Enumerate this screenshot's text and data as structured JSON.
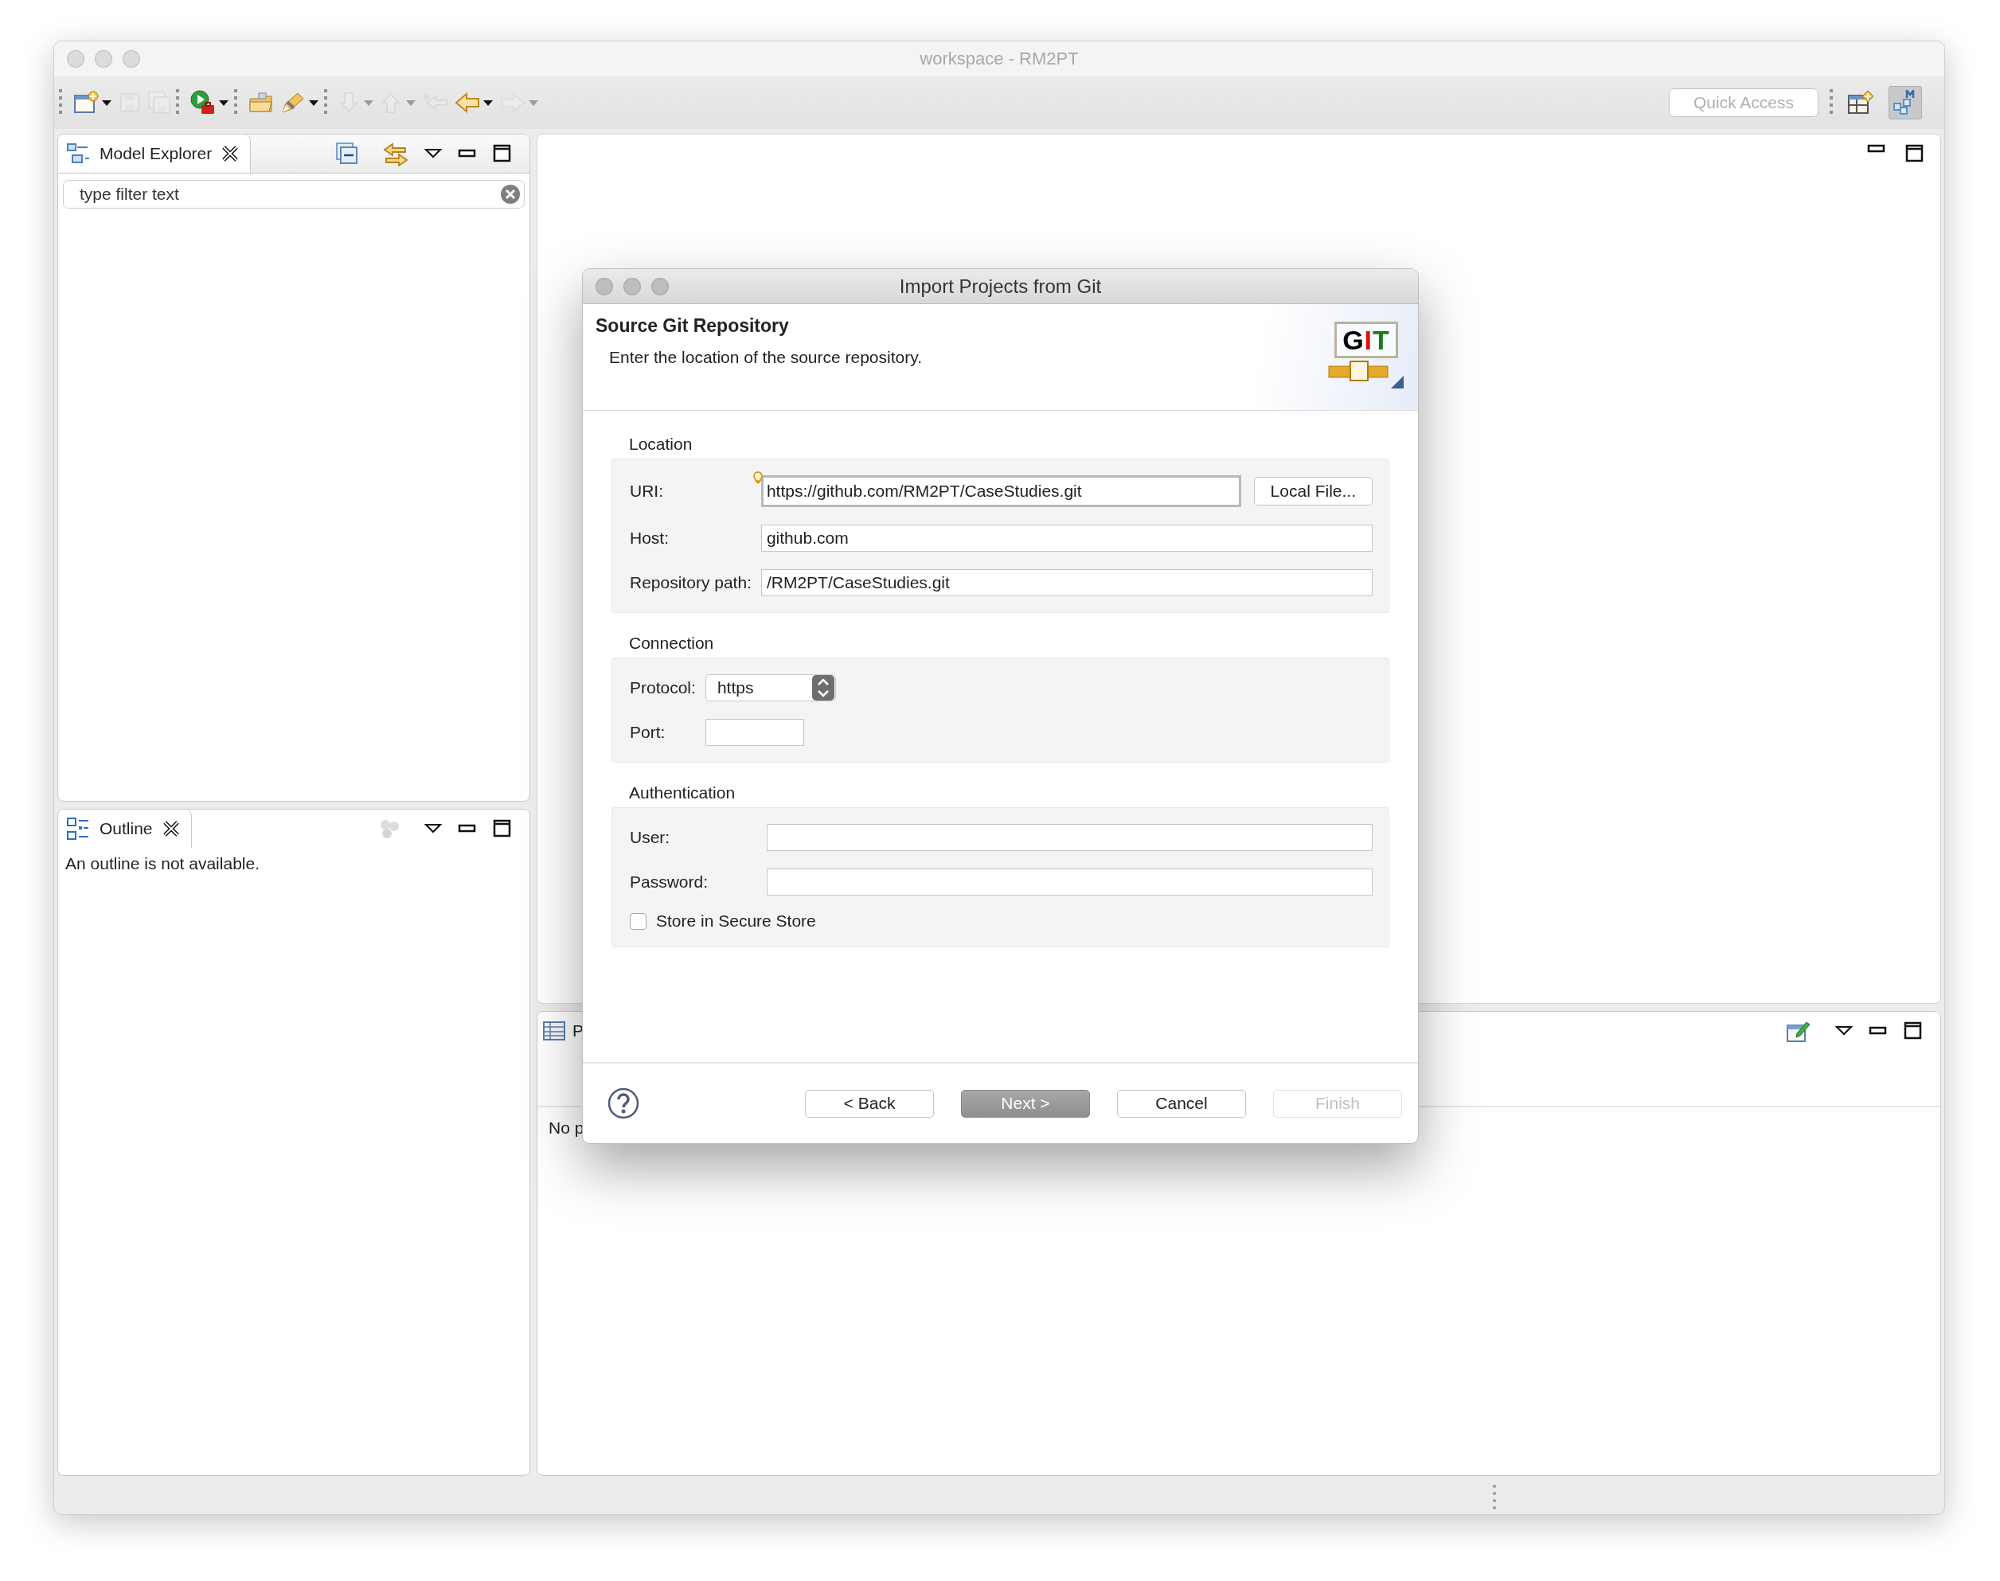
{
  "window": {
    "title": "workspace - RM2PT"
  },
  "toolbar": {
    "groups": [
      [
        {
          "kind": "new-wizard",
          "disabled": false,
          "dropdown": true
        },
        {
          "kind": "save",
          "disabled": true,
          "dropdown": false
        },
        {
          "kind": "save-all",
          "disabled": true,
          "dropdown": false
        }
      ],
      [
        {
          "kind": "run",
          "disabled": false,
          "dropdown": true
        }
      ],
      [
        {
          "kind": "open-folder",
          "disabled": false,
          "dropdown": false
        },
        {
          "kind": "pen",
          "disabled": false,
          "dropdown": true
        }
      ],
      [
        {
          "kind": "next-annotation",
          "disabled": true,
          "dropdown": true
        },
        {
          "kind": "prev-annotation",
          "disabled": true,
          "dropdown": true
        },
        {
          "kind": "last-edit",
          "disabled": true,
          "dropdown": false
        },
        {
          "kind": "back",
          "disabled": false,
          "dropdown": true
        },
        {
          "kind": "forward",
          "disabled": true,
          "dropdown": true
        }
      ]
    ],
    "quick_access": {
      "placeholder": "Quick Access"
    },
    "perspectives": [
      {
        "kind": "open-perspective",
        "selected": false
      },
      {
        "kind": "model",
        "selected": true
      }
    ]
  },
  "model_explorer": {
    "tab": "Model Explorer",
    "filter": {
      "placeholder": "type filter text"
    }
  },
  "outline": {
    "tab": "Outline",
    "message": "An outline is not available."
  },
  "bottom_panel": {
    "tab": "P",
    "message": "No p"
  },
  "dialog": {
    "title": "Import Projects from Git",
    "heading": "Source Git Repository",
    "description": "Enter the location of the source repository.",
    "logo": "GIT",
    "sections": [
      {
        "title": "Location",
        "rows": [
          {
            "kind": "text",
            "label": "URI:",
            "value": "https://github.com/RM2PT/CaseStudies.git",
            "focused": true,
            "button": "Local File..."
          },
          {
            "kind": "text",
            "label": "Host:",
            "value": "github.com",
            "focused": false
          },
          {
            "kind": "text",
            "label": "Repository path:",
            "value": "/RM2PT/CaseStudies.git",
            "focused": false
          }
        ]
      },
      {
        "title": "Connection",
        "rows": [
          {
            "kind": "select",
            "label": "Protocol:",
            "value": "https"
          },
          {
            "kind": "short",
            "label": "Port:",
            "focused": false
          }
        ]
      },
      {
        "title": "Authentication",
        "rows": [
          {
            "kind": "text",
            "label": "User:",
            "focused": false
          },
          {
            "kind": "password",
            "label": "Password:",
            "focused": false
          },
          {
            "kind": "checkbox",
            "label": "Store in Secure Store",
            "checked": false
          }
        ]
      }
    ],
    "buttons": [
      {
        "label": "< Back",
        "default": false,
        "disabled": false
      },
      {
        "label": "Next >",
        "default": true,
        "disabled": false
      },
      {
        "label": "Cancel",
        "default": false,
        "disabled": false
      },
      {
        "label": "Finish",
        "default": false,
        "disabled": true
      }
    ]
  }
}
